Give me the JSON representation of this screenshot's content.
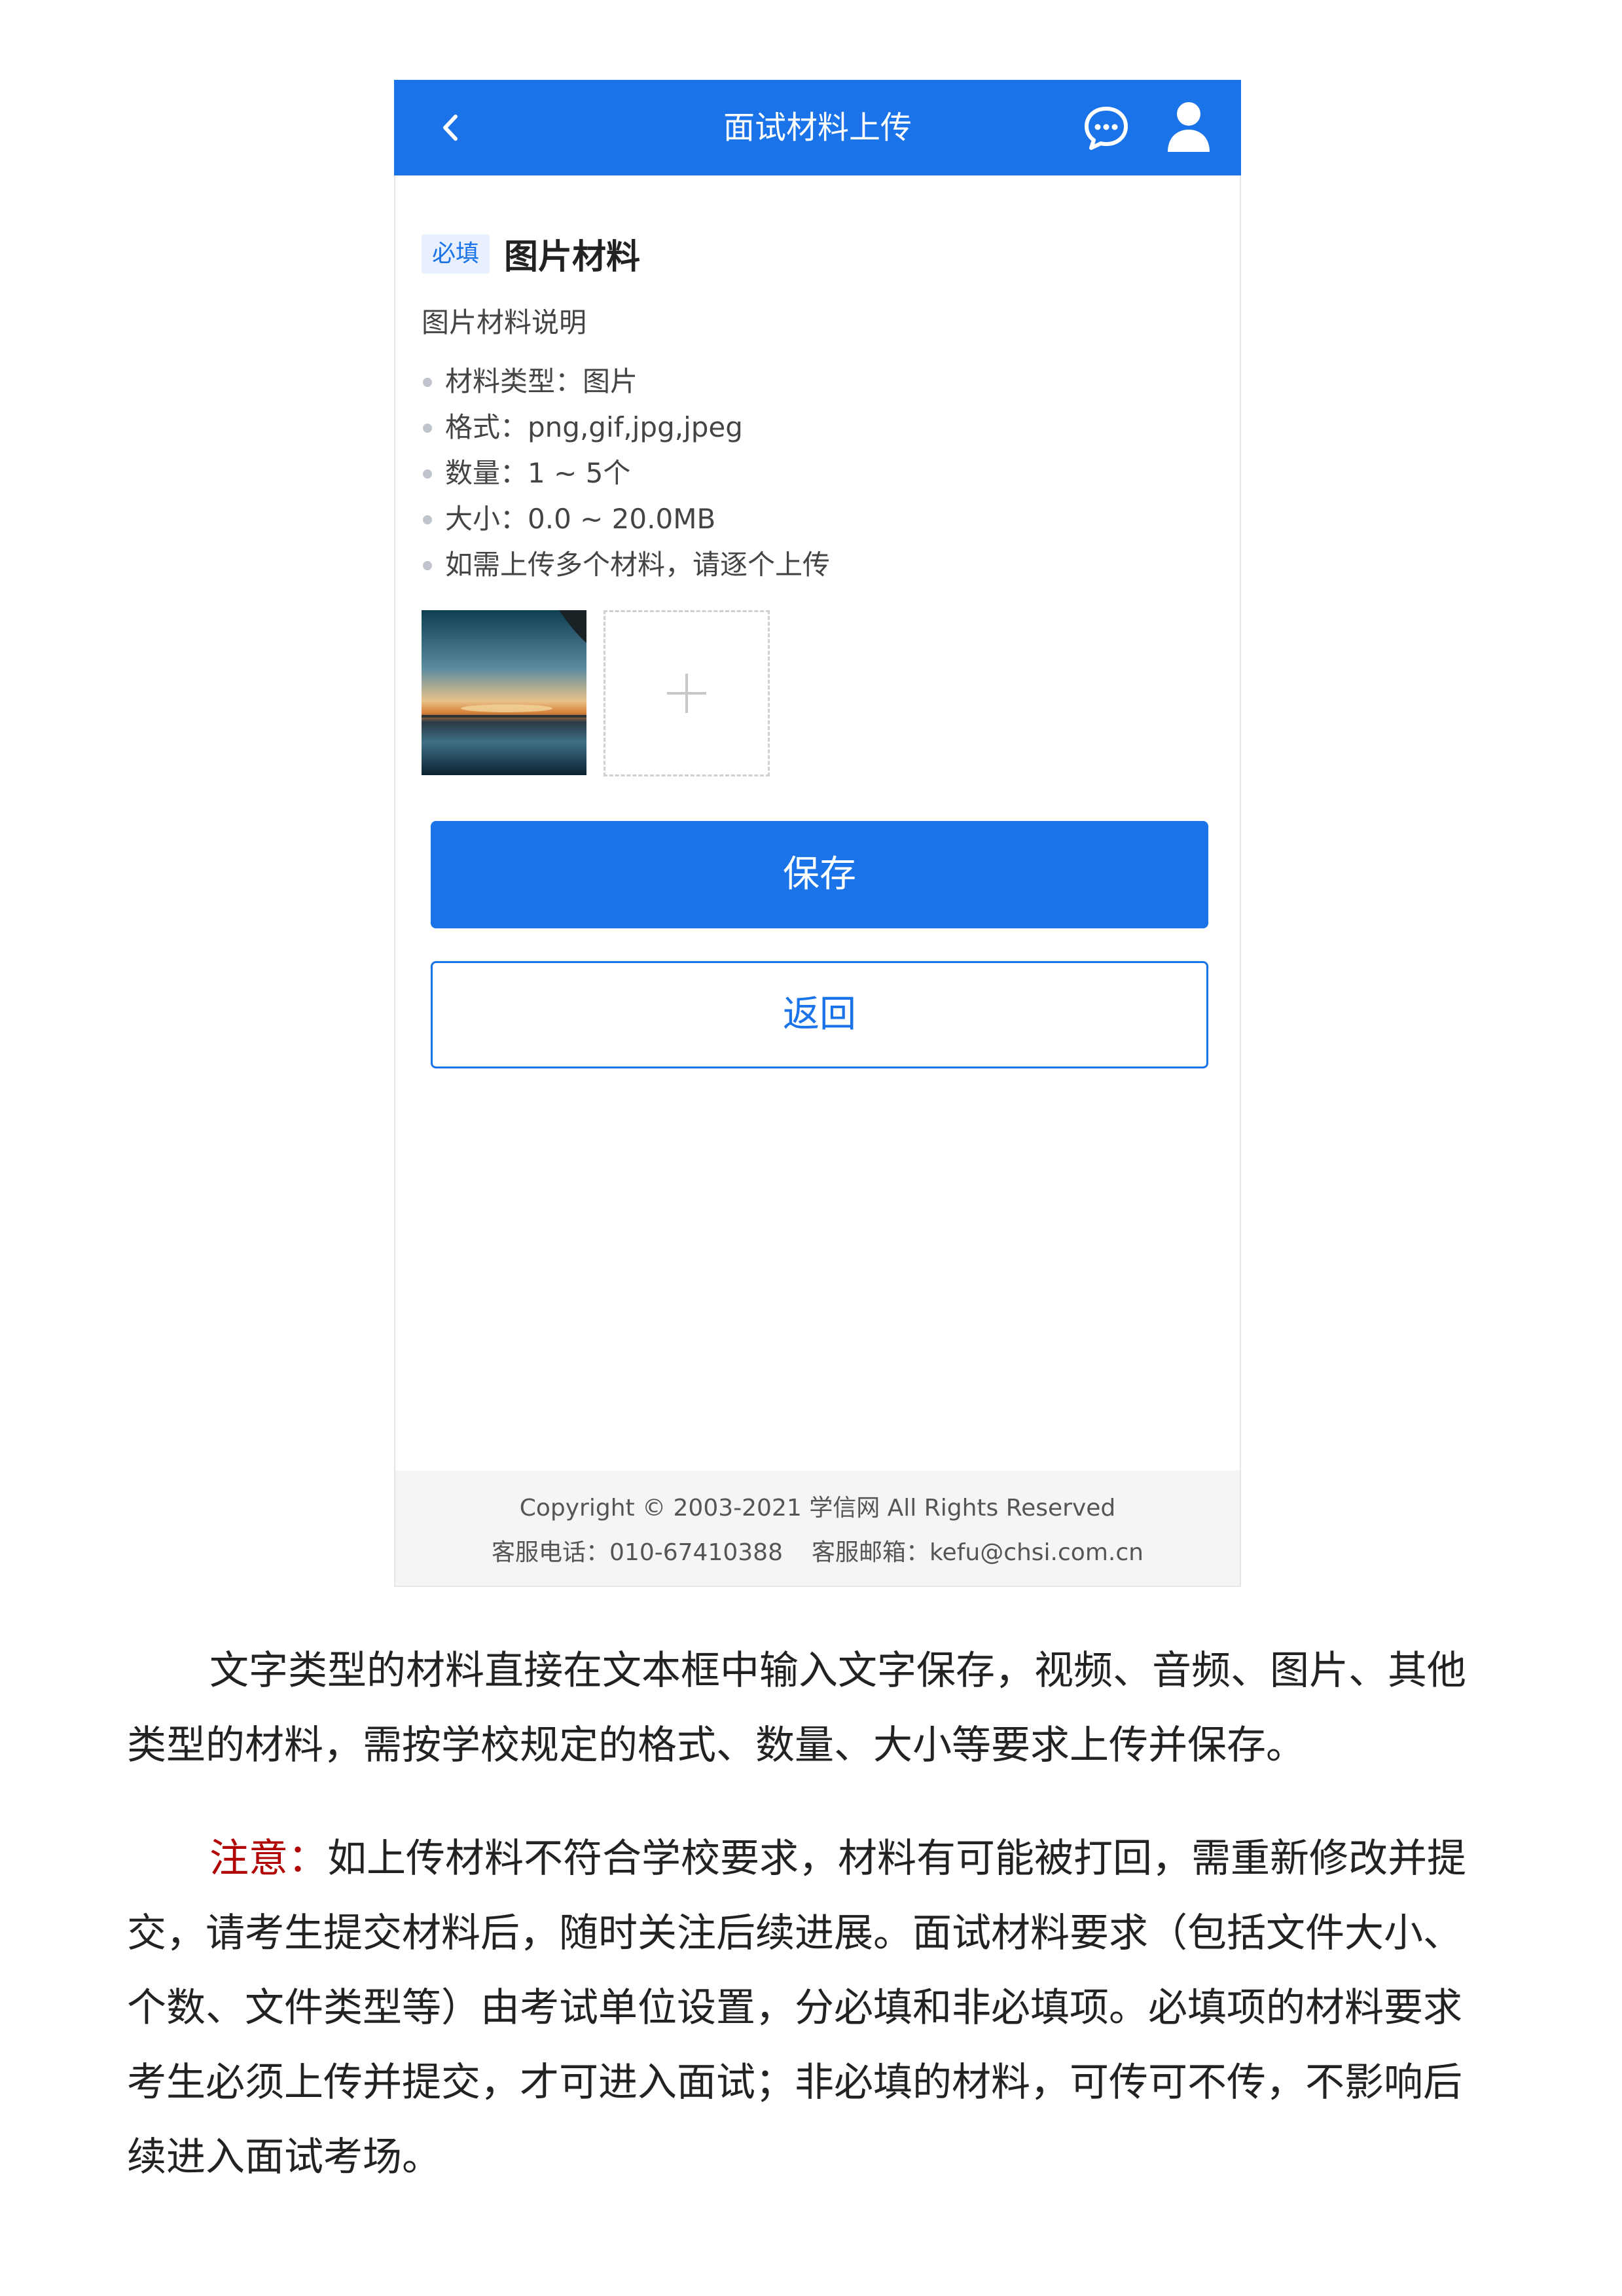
{
  "app": {
    "title": "面试材料上传"
  },
  "icons": {
    "back": "chevron-left-icon",
    "message": "chat-bubble-icon",
    "user": "user-icon",
    "add": "plus-icon"
  },
  "colors": {
    "primary": "#1a73e8",
    "badge_bg": "#e8f0fe",
    "note_red": "#b00000"
  },
  "field": {
    "badge": "必填",
    "title": "图片材料",
    "description": "图片材料说明",
    "requirements": [
      "材料类型：图片",
      "格式：png,gif,jpg,jpeg",
      "数量：1 ~ 5个",
      "大小：0.0 ~ 20.0MB",
      "如需上传多个材料，请逐个上传"
    ]
  },
  "buttons": {
    "save": "保存",
    "back": "返回"
  },
  "footer": {
    "copyright": "Copyright © 2003-2021 学信网 All Rights Reserved",
    "phone": "客服电话：010-67410388",
    "email": "客服邮箱：kefu@chsi.com.cn"
  },
  "article": {
    "paragraph1": "文字类型的材料直接在文本框中输入文字保存，视频、音频、图片、其他类型的材料，需按学校规定的格式、数量、大小等要求上传并保存。",
    "note_label": "注意：",
    "paragraph2": "如上传材料不符合学校要求，材料有可能被打回，需重新修改并提交，请考生提交材料后，随时关注后续进展。面试材料要求（包括文件大小、个数、文件类型等）由考试单位设置，分必填和非必填项。必填项的材料要求考生必须上传并提交，才可进入面试；非必填的材料，可传可不传，不影响后续进入面试考场。"
  }
}
